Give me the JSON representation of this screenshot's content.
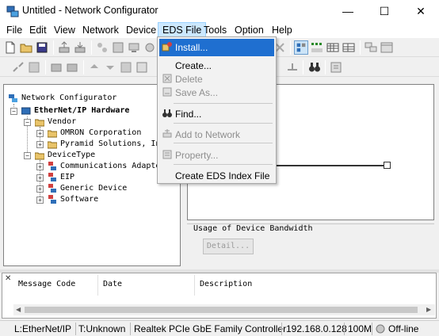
{
  "window": {
    "title": "Untitled - Network Configurator",
    "minimize_glyph": "—",
    "maximize_glyph": "☐",
    "close_glyph": "✕"
  },
  "menu": {
    "items": [
      "File",
      "Edit",
      "View",
      "Network",
      "Device",
      "EDS File",
      "Tools",
      "Option",
      "Help"
    ],
    "active": "EDS File"
  },
  "eds_menu": {
    "items": [
      {
        "label": "Install...",
        "icon": "install-icon",
        "enabled": true,
        "highlighted": true
      },
      {
        "label": "Create...",
        "icon": "none",
        "enabled": true,
        "highlighted": false
      },
      {
        "label": "Delete",
        "icon": "delete-icon",
        "enabled": false,
        "highlighted": false
      },
      {
        "label": "Save As...",
        "icon": "save-as-icon",
        "enabled": false,
        "highlighted": false
      },
      {
        "label": "Find...",
        "icon": "binoculars-icon",
        "enabled": true,
        "highlighted": false
      },
      {
        "label": "Add to Network",
        "icon": "add-to-network-icon",
        "enabled": false,
        "highlighted": false
      },
      {
        "label": "Property...",
        "icon": "property-icon",
        "enabled": false,
        "highlighted": false
      },
      {
        "label": "Create EDS Index File",
        "icon": "none",
        "enabled": true,
        "highlighted": false
      }
    ]
  },
  "tree": {
    "root": "Network Configurator",
    "hardware": "EtherNet/IP Hardware",
    "vendor": "Vendor",
    "vendors": [
      "OMRON Corporation",
      "Pyramid Solutions, Inc."
    ],
    "device_type": "DeviceType",
    "device_types": [
      "Communications Adapter",
      "EIP",
      "Generic Device",
      "Software"
    ],
    "expanded_glyph": "−",
    "collapsed_glyph": "+"
  },
  "bandwidth": {
    "label": "Usage of Device Bandwidth",
    "detail_button": "Detail..."
  },
  "messages": {
    "close_glyph": "✕",
    "columns": [
      "Message Code",
      "Date",
      "Description"
    ],
    "scroll_left": "◀",
    "scroll_right": "▶"
  },
  "status": {
    "network": "L:EtherNet/IP",
    "device": "T:Unknown",
    "adapter": "Realtek PCIe GbE Family Controller",
    "ip": "192.168.0.128",
    "speed": "100M",
    "connection": "Off-line"
  },
  "colors": {
    "highlight": "#1f6fd0",
    "menu_active": "#cce8ff",
    "network_icon": "#2f6fb8",
    "folder": "#e9c46a"
  }
}
